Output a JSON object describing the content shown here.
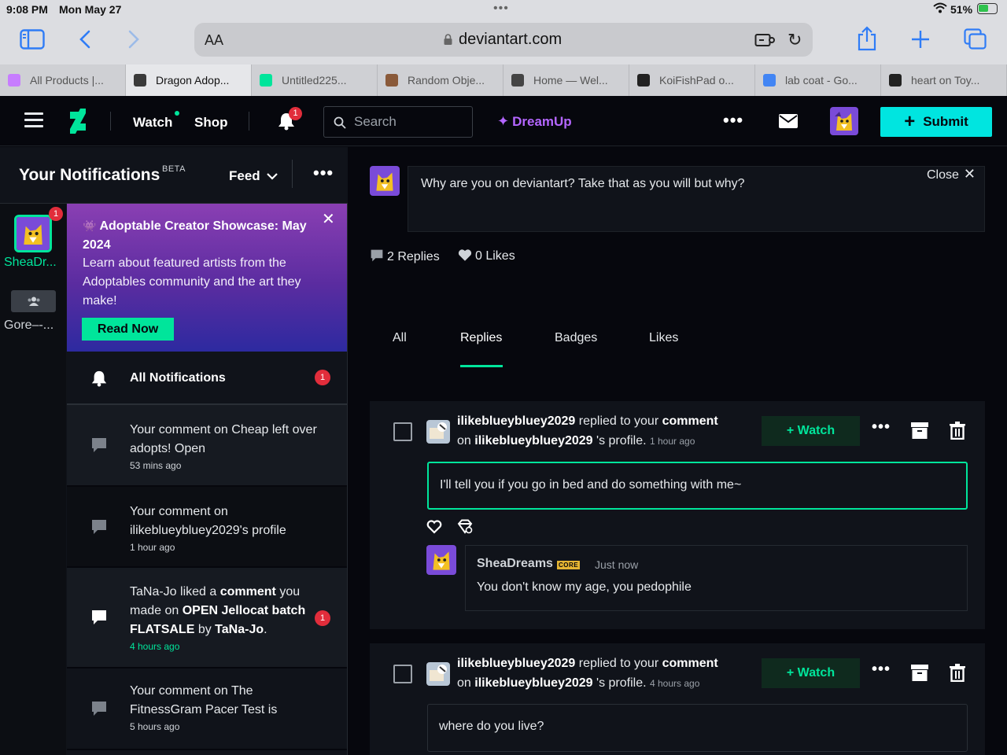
{
  "status_bar": {
    "time": "9:08 PM",
    "date": "Mon May 27",
    "battery": "51%"
  },
  "browser": {
    "aa_label": "AA",
    "domain": "deviantart.com",
    "tabs": [
      {
        "label": "All Products |...",
        "favicon_color": "#c77dff"
      },
      {
        "label": "Dragon Adop...",
        "favicon_color": "#3a3a3a",
        "active": true
      },
      {
        "label": "Untitled225...",
        "favicon_color": "#00e59b"
      },
      {
        "label": "Random Obje...",
        "favicon_color": "#8a5a3a"
      },
      {
        "label": "Home — Wel...",
        "favicon_color": "#444444"
      },
      {
        "label": "KoiFishPad o...",
        "favicon_color": "#222222"
      },
      {
        "label": "lab coat - Go...",
        "favicon_color": "#4285f4"
      },
      {
        "label": "heart on Toy...",
        "favicon_color": "#222222"
      }
    ]
  },
  "header": {
    "watch": "Watch",
    "shop": "Shop",
    "bell_count": "1",
    "search_placeholder": "Search",
    "dreamup": "DreamUp",
    "submit": "Submit",
    "accent_color": "#00e59b",
    "submit_color": "#00e5e0"
  },
  "sidebar": {
    "title": "Your Notifications",
    "beta": "BETA",
    "feed": "Feed",
    "rail": [
      {
        "label": "SheaDr...",
        "badge": "1"
      },
      {
        "label": "Gore–-..."
      }
    ],
    "promo": {
      "title": "Adoptable Creator Showcase: May 2024",
      "body": "Learn about featured artists from the Adoptables community and the art they make!",
      "button": "Read Now"
    },
    "all_notifications": {
      "label": "All Notifications",
      "badge": "1"
    },
    "items": [
      {
        "text": "Your comment on Cheap left over adopts! Open",
        "time": "53 mins ago"
      },
      {
        "text": "Your comment on ilikeblueybluey2029's profile",
        "time": "1 hour ago"
      },
      {
        "actor": "TaNa-Jo",
        "liked": "liked a",
        "comment_word": "comment",
        "mid": "you made on",
        "deviation": "OPEN Jellocat batch FLATSALE",
        "by": "by",
        "author": "TaNa-Jo",
        "end": ".",
        "time": "4 hours ago",
        "badge": "1"
      },
      {
        "text": "Your comment on The FitnessGram Pacer Test is",
        "time": "5 hours ago"
      }
    ]
  },
  "main": {
    "post_text": "Why are you on deviantart? Take that as you will but why?",
    "close": "Close",
    "replies_count": "2 Replies",
    "likes_count": "0 Likes",
    "filter_tabs": [
      "All",
      "Replies",
      "Badges",
      "Likes"
    ],
    "active_tab": "Replies",
    "cards": [
      {
        "user": "ilikeblueybluey2029",
        "replied_to": "replied to your",
        "comment": "comment",
        "on": "on",
        "profile_owner": "ilikeblueybluey2029",
        "profile_suffix": "'s profile.",
        "time": "1 hour ago",
        "watch": "+ Watch",
        "message": "I'll tell you if you go in bed and do something with me~",
        "reply": {
          "name": "SheaDreams",
          "badge": "CORE",
          "time": "Just now",
          "text": "You don't know my age, you pedophile"
        }
      },
      {
        "user": "ilikeblueybluey2029",
        "replied_to": "replied to your",
        "comment": "comment",
        "on": "on",
        "profile_owner": "ilikeblueybluey2029",
        "profile_suffix": "'s profile.",
        "time": "4 hours ago",
        "watch": "+ Watch",
        "message": "where do you live?"
      }
    ]
  }
}
